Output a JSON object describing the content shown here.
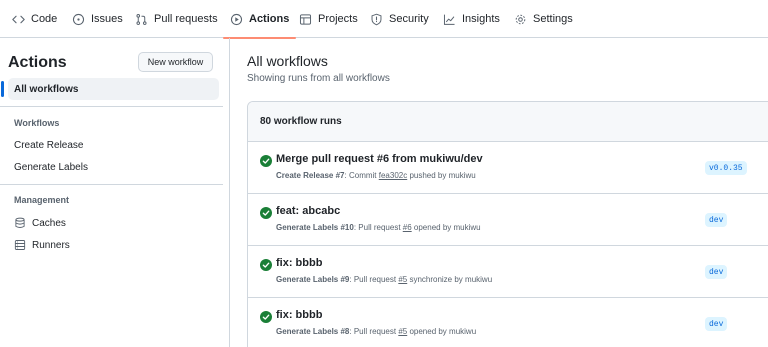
{
  "nav": {
    "tabs": [
      {
        "label": "Code",
        "icon": "code-icon"
      },
      {
        "label": "Issues",
        "icon": "issue-opened-icon"
      },
      {
        "label": "Pull requests",
        "icon": "git-pull-request-icon"
      },
      {
        "label": "Actions",
        "icon": "play-icon",
        "active": true
      },
      {
        "label": "Projects",
        "icon": "table-icon"
      },
      {
        "label": "Security",
        "icon": "shield-icon"
      },
      {
        "label": "Insights",
        "icon": "graph-icon"
      },
      {
        "label": "Settings",
        "icon": "gear-icon"
      }
    ]
  },
  "sidebar": {
    "title": "Actions",
    "new_workflow_label": "New workflow",
    "all_workflows_label": "All workflows",
    "workflows_section": "Workflows",
    "workflows": [
      "Create Release",
      "Generate Labels"
    ],
    "management_section": "Management",
    "management": [
      {
        "label": "Caches",
        "icon": "database-icon"
      },
      {
        "label": "Runners",
        "icon": "server-icon"
      }
    ]
  },
  "main": {
    "title": "All workflows",
    "subtitle": "Showing runs from all workflows",
    "runs_count_label": "80 workflow runs",
    "runs": [
      {
        "title": "Merge pull request #6 from mukiwu/dev",
        "workflow": "Create Release",
        "run_number": "#7",
        "meta_prefix": ": Commit ",
        "link": "fea302c",
        "meta_suffix": " pushed by mukiwu",
        "branch": "v0.0.35",
        "status": "success"
      },
      {
        "title": "feat: abcabc",
        "workflow": "Generate Labels",
        "run_number": "#10",
        "meta_prefix": ": Pull request ",
        "link": "#6",
        "meta_suffix": " opened by mukiwu",
        "branch": "dev",
        "status": "success"
      },
      {
        "title": "fix: bbbb",
        "workflow": "Generate Labels",
        "run_number": "#9",
        "meta_prefix": ": Pull request ",
        "link": "#5",
        "meta_suffix": " synchronize by mukiwu",
        "branch": "dev",
        "status": "success"
      },
      {
        "title": "fix: bbbb",
        "workflow": "Generate Labels",
        "run_number": "#8",
        "meta_prefix": ": Pull request ",
        "link": "#5",
        "meta_suffix": " opened by mukiwu",
        "branch": "dev",
        "status": "success"
      }
    ]
  },
  "colors": {
    "accent": "#0969da",
    "success": "#1a7f37",
    "active_tab_underline": "#fd8c73",
    "border": "#d0d7de",
    "branch_bg": "#ddf4ff"
  }
}
